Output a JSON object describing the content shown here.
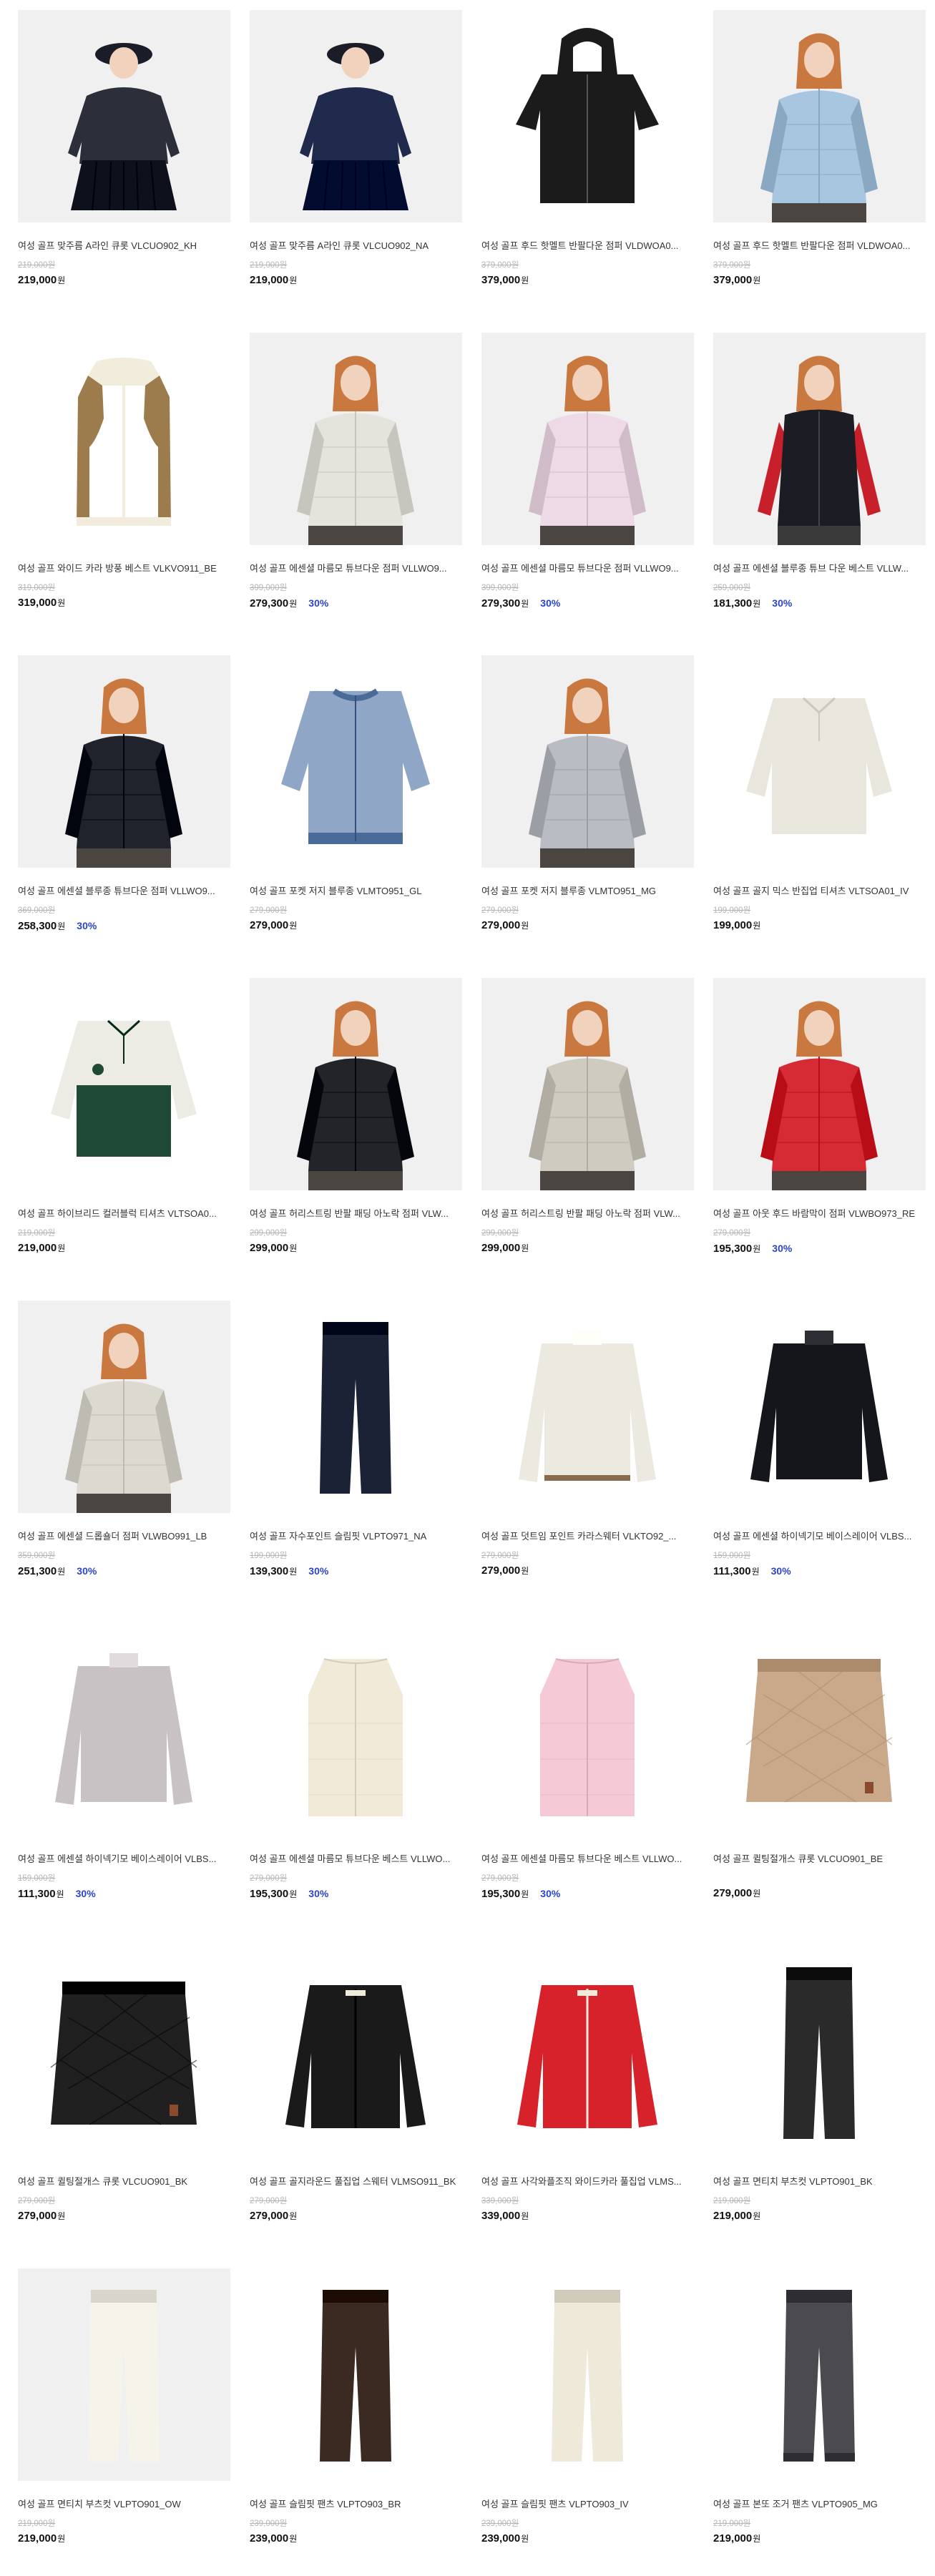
{
  "products": [
    {
      "name": "여성 골프 맞주름 A라인 큐롯 VLCUO902_KH",
      "orig": "219,000원",
      "price": "219,000",
      "won": "원",
      "disc": "",
      "img": "model-skirt",
      "bg": "#f0f0f0",
      "color": "#2c2f3a"
    },
    {
      "name": "여성 골프 맞주름 A라인 큐롯 VLCUO902_NA",
      "orig": "219,000원",
      "price": "219,000",
      "won": "원",
      "disc": "",
      "img": "model-skirt",
      "bg": "#f0f0f0",
      "color": "#1f2a4d"
    },
    {
      "name": "여성 골프 후드 핫멜트 반팔다운 점퍼 VLDWOA0...",
      "orig": "379,000원",
      "price": "379,000",
      "won": "원",
      "disc": "",
      "img": "hood-jacket",
      "bg": "#ffffff",
      "color": "#1b1b1b"
    },
    {
      "name": "여성 골프 후드 핫멜트 반팔다운 점퍼 VLDWOA0...",
      "orig": "379,000원",
      "price": "379,000",
      "won": "원",
      "disc": "",
      "img": "model-jacket",
      "bg": "#f0f0f0",
      "color": "#a9c6e0"
    },
    {
      "name": "여성 골프 와이드 카라 방풍 베스트 VLKVO911_BE",
      "orig": "319,000원",
      "price": "319,000",
      "won": "원",
      "disc": "",
      "img": "vest",
      "bg": "#ffffff",
      "color": "#9c7b4c"
    },
    {
      "name": "여성 골프 에센셜 마름모 튜브다운 점퍼 VLLWO9...",
      "orig": "399,000원",
      "price": "279,300",
      "won": "원",
      "disc": "30%",
      "img": "model-jacket",
      "bg": "#f0f0f0",
      "color": "#e4e3dc"
    },
    {
      "name": "여성 골프 에센셜 마름모 튜브다운 점퍼 VLLWO9...",
      "orig": "399,000원",
      "price": "279,300",
      "won": "원",
      "disc": "30%",
      "img": "model-jacket",
      "bg": "#f0f0f0",
      "color": "#eed9e6"
    },
    {
      "name": "여성 골프 에센셜 블루종 튜브 다운 베스트 VLLW...",
      "orig": "259,000원",
      "price": "181,300",
      "won": "원",
      "disc": "30%",
      "img": "model-vest",
      "bg": "#f0f0f0",
      "color": "#1b1c24"
    },
    {
      "name": "여성 골프 에센셜 블루종 튜브다운 점퍼 VLLWO9...",
      "orig": "369,000원",
      "price": "258,300",
      "won": "원",
      "disc": "30%",
      "img": "model-jacket",
      "bg": "#f0f0f0",
      "color": "#20232b"
    },
    {
      "name": "여성 골프 포켓 저지 블루종 VLMTO951_GL",
      "orig": "279,000원",
      "price": "279,000",
      "won": "원",
      "disc": "",
      "img": "bomber",
      "bg": "#ffffff",
      "color": "#8fa6c7"
    },
    {
      "name": "여성 골프 포켓 저지 블루종 VLMTO951_MG",
      "orig": "279,000원",
      "price": "279,000",
      "won": "원",
      "disc": "",
      "img": "model-jacket",
      "bg": "#f0f0f0",
      "color": "#b9bcc2"
    },
    {
      "name": "여성 골프 골지 믹스 반집업 티셔츠 VLTSOA01_IV",
      "orig": "199,000원",
      "price": "199,000",
      "won": "원",
      "disc": "",
      "img": "tee",
      "bg": "#ffffff",
      "color": "#e9e6de"
    },
    {
      "name": "여성 골프 하이브리드 컬러블럭 티셔츠 VLTSOA0...",
      "orig": "219,000원",
      "price": "219,000",
      "won": "원",
      "disc": "",
      "img": "colorblock",
      "bg": "#ffffff",
      "color": "#1f4a36"
    },
    {
      "name": "여성 골프 허리스트링 반팔 패딩 아노락 점퍼 VLW...",
      "orig": "299,000원",
      "price": "299,000",
      "won": "원",
      "disc": "",
      "img": "model-jacket",
      "bg": "#f0f0f0",
      "color": "#22242a"
    },
    {
      "name": "여성 골프 허리스트링 반팔 패딩 아노락 점퍼 VLW...",
      "orig": "299,000원",
      "price": "299,000",
      "won": "원",
      "disc": "",
      "img": "model-jacket",
      "bg": "#f0f0f0",
      "color": "#cfcbc0"
    },
    {
      "name": "여성 골프 아웃 후드 바람막이 점퍼 VLWBO973_RE",
      "orig": "279,000원",
      "price": "195,300",
      "won": "원",
      "disc": "30%",
      "img": "model-jacket",
      "bg": "#f0f0f0",
      "color": "#d62a35"
    },
    {
      "name": "여성 골프 에센셜 드롭숄더 점퍼 VLWBO991_LB",
      "orig": "359,000원",
      "price": "251,300",
      "won": "원",
      "disc": "30%",
      "img": "model-jacket",
      "bg": "#f0f0f0",
      "color": "#dcd9d0"
    },
    {
      "name": "여성 골프 자수포인트 슬림핏 VLPTO971_NA",
      "orig": "199,000원",
      "price": "139,300",
      "won": "원",
      "disc": "30%",
      "img": "pants",
      "bg": "#ffffff",
      "color": "#1c2236"
    },
    {
      "name": "여성 골프 덧트임 포인트 카라스웨터 VLKTO92_...",
      "orig": "279,000원",
      "price": "279,000",
      "won": "원",
      "disc": "",
      "img": "sweater",
      "bg": "#ffffff",
      "color": "#ece9e1"
    },
    {
      "name": "여성 골프 에센셜 하이넥기모 베이스레이어 VLBS...",
      "orig": "159,000원",
      "price": "111,300",
      "won": "원",
      "disc": "30%",
      "img": "longsleeve",
      "bg": "#ffffff",
      "color": "#14161c"
    },
    {
      "name": "여성 골프 에센셜 하이넥기모 베이스레이어 VLBS...",
      "orig": "159,000원",
      "price": "111,300",
      "won": "원",
      "disc": "30%",
      "img": "longsleeve",
      "bg": "#ffffff",
      "color": "#c8c2c4"
    },
    {
      "name": "여성 골프 에센셜 마름모 튜브다운 베스트 VLLWO...",
      "orig": "279,000원",
      "price": "195,300",
      "won": "원",
      "disc": "30%",
      "img": "down-vest",
      "bg": "#ffffff",
      "color": "#f1ead8"
    },
    {
      "name": "여성 골프 에센셜 마름모 튜브다운 베스트 VLLWO...",
      "orig": "279,000원",
      "price": "195,300",
      "won": "원",
      "disc": "30%",
      "img": "down-vest",
      "bg": "#ffffff",
      "color": "#f5c9d6"
    },
    {
      "name": "여성 골프 퀼팅절개스 큐롯 VLCUO901_BE",
      "orig": "",
      "price": "279,000",
      "won": "원",
      "disc": "",
      "img": "quilt-skirt",
      "bg": "#ffffff",
      "color": "#c9a98a"
    },
    {
      "name": "여성 골프 퀼팅절개스 큐롯 VLCUO901_BK",
      "orig": "279,000원",
      "price": "279,000",
      "won": "원",
      "disc": "",
      "img": "quilt-skirt",
      "bg": "#ffffff",
      "color": "#202020"
    },
    {
      "name": "여성 골프 골지라운드 풀집업 스웨터 VLMSO911_BK",
      "orig": "279,000원",
      "price": "279,000",
      "won": "원",
      "disc": "",
      "img": "cardigan",
      "bg": "#ffffff",
      "color": "#1a1a1a"
    },
    {
      "name": "여성 골프 사각와플조직 와이드카라 풀집업 VLMS...",
      "orig": "339,000원",
      "price": "339,000",
      "won": "원",
      "disc": "",
      "img": "zip-sweater",
      "bg": "#ffffff",
      "color": "#d7222c"
    },
    {
      "name": "여성 골프 면티치 부츠컷 VLPTO901_BK",
      "orig": "219,000원",
      "price": "219,000",
      "won": "원",
      "disc": "",
      "img": "pants",
      "bg": "#ffffff",
      "color": "#2a2a2a"
    },
    {
      "name": "여성 골프 면티치 부츠컷 VLPTO901_OW",
      "orig": "219,000원",
      "price": "219,000",
      "won": "원",
      "disc": "",
      "img": "pants",
      "bg": "#f0f0f0",
      "color": "#f6f3ea"
    },
    {
      "name": "여성 골프 슬림핏 팬츠 VLPTO903_BR",
      "orig": "239,000원",
      "price": "239,000",
      "won": "원",
      "disc": "",
      "img": "pants",
      "bg": "#ffffff",
      "color": "#3b2a22"
    },
    {
      "name": "여성 골프 슬림핏 팬츠 VLPTO903_IV",
      "orig": "239,000원",
      "price": "239,000",
      "won": "원",
      "disc": "",
      "img": "pants",
      "bg": "#ffffff",
      "color": "#efe9da"
    },
    {
      "name": "여성 골프 본또 조거 팬츠 VLPTO905_MG",
      "orig": "219,000원",
      "price": "219,000",
      "won": "원",
      "disc": "",
      "img": "jogger",
      "bg": "#ffffff",
      "color": "#4a4a4f"
    }
  ]
}
